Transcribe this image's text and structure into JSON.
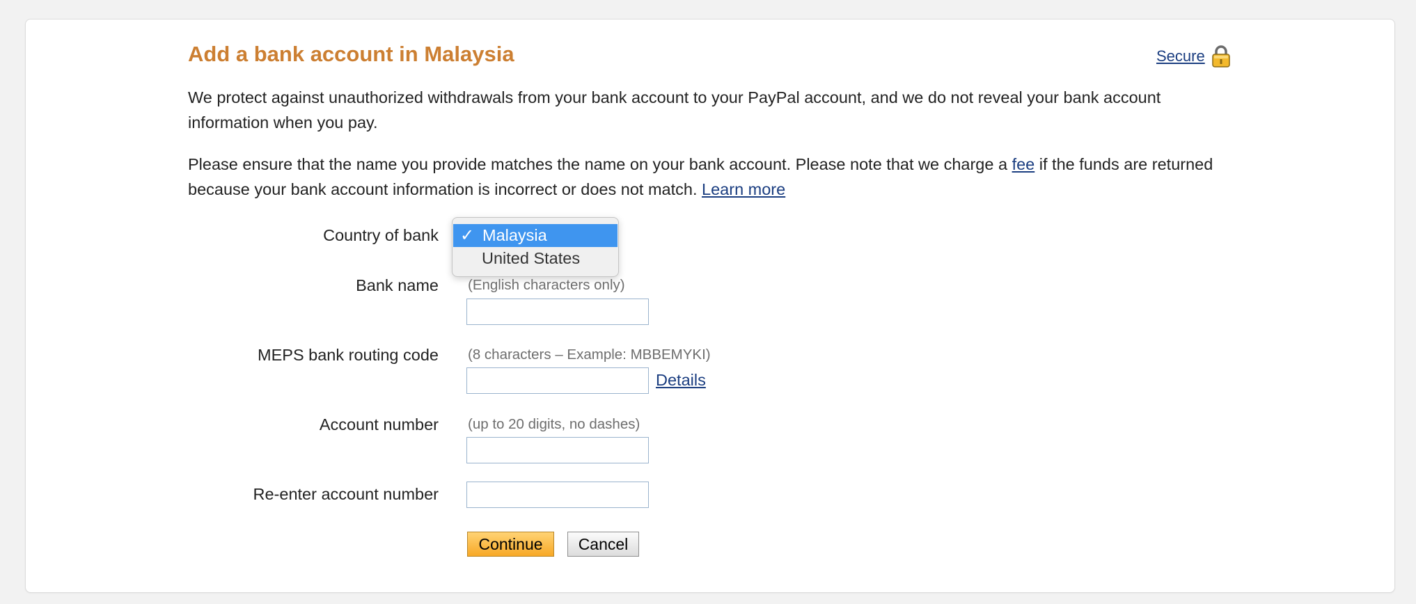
{
  "page": {
    "title": "Add a bank account in Malaysia",
    "secure_label": "Secure",
    "paragraph1": "We protect against unauthorized withdrawals from your bank account to your PayPal account, and we do not reveal your bank account information when you pay.",
    "paragraph2_before_fee": "Please ensure that the name you provide matches the name on your bank account. Please note that we charge a ",
    "fee_link": "fee",
    "paragraph2_after_fee": " if the funds are returned because your bank account information is incorrect or does not match. ",
    "learn_more_link": "Learn more"
  },
  "form": {
    "country": {
      "label": "Country of bank",
      "options": [
        "Malaysia",
        "United States"
      ],
      "selected": "Malaysia",
      "check_glyph": "✓"
    },
    "bank_name": {
      "label": "Bank name",
      "hint": "(English characters only)",
      "value": ""
    },
    "routing_code": {
      "label": "MEPS bank routing code",
      "hint": "(8 characters – Example: MBBEMYKI)",
      "value": "",
      "details_link": "Details"
    },
    "account_number": {
      "label": "Account number",
      "hint": "(up to 20 digits, no dashes)",
      "value": ""
    },
    "reenter_account": {
      "label": "Re-enter account number",
      "value": ""
    }
  },
  "buttons": {
    "continue": "Continue",
    "cancel": "Cancel"
  },
  "icons": {
    "secure": "padlock-icon",
    "selected_option": "checkmark-icon"
  },
  "colors": {
    "title": "#cc7f32",
    "link": "#1a3d80",
    "dropdown_selected": "#3f95ef",
    "continue_button": "#f7a826"
  }
}
